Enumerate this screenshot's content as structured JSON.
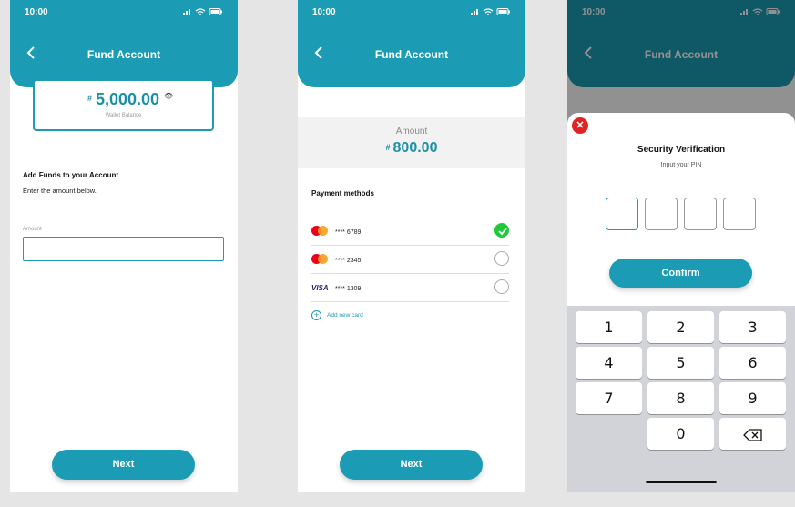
{
  "status": {
    "time": "10:00"
  },
  "screen1": {
    "header_title": "Fund Account",
    "wallet": {
      "currency": "#",
      "amount": "5,000.00",
      "label": "Wallet Balance"
    },
    "section_title": "Add Funds to your Account",
    "section_text": "Enter the amount below.",
    "amount_label": "Amount",
    "next_label": "Next"
  },
  "screen2": {
    "header_title": "Fund Account",
    "amount_label": "Amount",
    "currency": "#",
    "amount": "800.00",
    "payment_title": "Payment methods",
    "cards": [
      {
        "brand": "mastercard",
        "number": "**** 6789",
        "selected": true
      },
      {
        "brand": "mastercard",
        "number": "**** 2345",
        "selected": false
      },
      {
        "brand": "VISA",
        "number": "**** 1309",
        "selected": false
      }
    ],
    "add_card_label": "Add new card",
    "next_label": "Next"
  },
  "screen3": {
    "header_title": "Fund Account",
    "sheet_title": "Security Verification",
    "sheet_subtitle": "Input your PIN",
    "confirm_label": "Confirm",
    "keys": [
      "1",
      "2",
      "3",
      "4",
      "5",
      "6",
      "7",
      "8",
      "9",
      "0"
    ]
  },
  "colors": {
    "primary": "#1c9bb4",
    "selected": "#22c73c",
    "danger": "#e02424"
  }
}
